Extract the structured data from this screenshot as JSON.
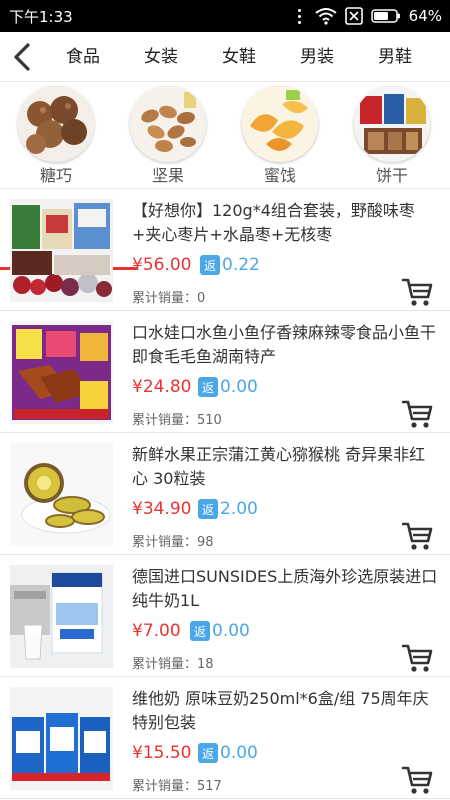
{
  "status_bar": {
    "time": "下午1:33",
    "battery": "64%"
  },
  "nav": {
    "categories": [
      "食品",
      "女装",
      "女鞋",
      "男装",
      "男鞋"
    ]
  },
  "sub_categories": [
    {
      "label": "糖巧",
      "selected": true
    },
    {
      "label": "坚果",
      "selected": false
    },
    {
      "label": "蜜饯",
      "selected": false
    },
    {
      "label": "饼干",
      "selected": false
    }
  ],
  "products": [
    {
      "title": "【好想你】120g*4组合套装，野酸味枣+夹心枣片+水晶枣+无核枣",
      "price": "¥56.00",
      "rebate_badge": "返",
      "rebate": "0.22",
      "sales_label": "累计销量：",
      "sales": "0"
    },
    {
      "title": "口水娃口水鱼小鱼仔香辣麻辣零食品小鱼干即食毛毛鱼湖南特产",
      "price": "¥24.80",
      "rebate_badge": "返",
      "rebate": "0.00",
      "sales_label": "累计销量：",
      "sales": "510"
    },
    {
      "title": "新鲜水果正宗蒲江黄心猕猴桃 奇异果非红心 30粒装",
      "price": "¥34.90",
      "rebate_badge": "返",
      "rebate": "2.00",
      "sales_label": "累计销量：",
      "sales": "98"
    },
    {
      "title": "德国进口SUNSIDES上质海外珍选原装进口纯牛奶1L",
      "price": "¥7.00",
      "rebate_badge": "返",
      "rebate": "0.00",
      "sales_label": "累计销量：",
      "sales": "18"
    },
    {
      "title": "维他奶 原味豆奶250ml*6盒/组 75周年庆特别包装",
      "price": "¥15.50",
      "rebate_badge": "返",
      "rebate": "0.00",
      "sales_label": "累计销量：",
      "sales": "517"
    }
  ],
  "colors": {
    "price": "#e8332f",
    "rebate": "#4aa7e8",
    "underline": "#e8332f"
  },
  "icons": {
    "back": "chevron-left-icon",
    "cart": "shopping-cart-icon",
    "wifi": "wifi-icon",
    "sim": "no-sim-icon",
    "battery": "battery-icon"
  }
}
